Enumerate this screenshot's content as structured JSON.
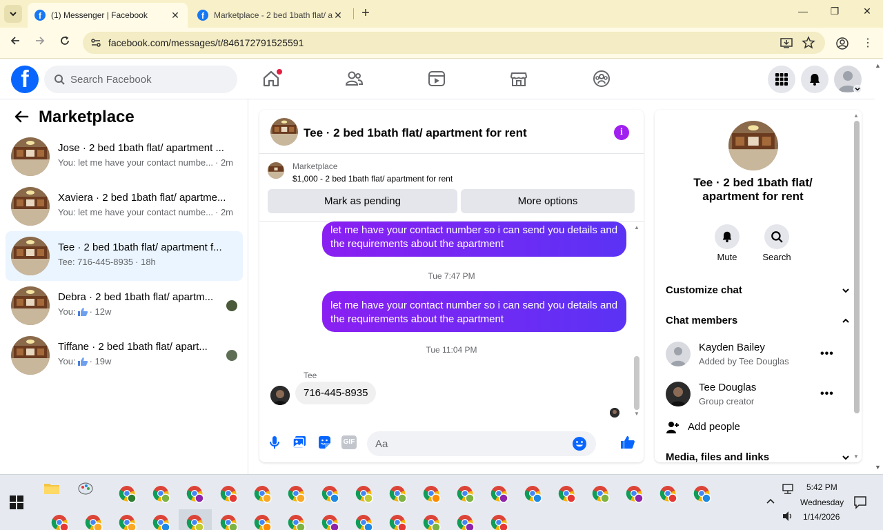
{
  "browser": {
    "tabs": [
      {
        "title": "(1) Messenger | Facebook",
        "close": "✕"
      },
      {
        "title": "Marketplace - 2 bed 1bath flat/ ap",
        "close": "✕"
      }
    ],
    "new_tab": "+",
    "window_controls": {
      "minimize": "—",
      "restore": "❐",
      "close": "✕"
    },
    "url": "facebook.com/messages/t/846172791525591"
  },
  "fb_header": {
    "logo": "f",
    "search_placeholder": "Search Facebook"
  },
  "left_pane": {
    "title": "Marketplace",
    "conversations": [
      {
        "name": "Jose · 2 bed 1bath flat/ apartment ...",
        "snippet": "You: let me have your contact numbe...",
        "time": "· 2m"
      },
      {
        "name": "Xaviera · 2 bed 1bath flat/ apartme...",
        "snippet": "You: let me have your contact numbe...",
        "time": "· 2m"
      },
      {
        "name": "Tee · 2 bed 1bath flat/ apartment f...",
        "snippet": "Tee: 716-445-8935",
        "time": "· 18h"
      },
      {
        "name": "Debra · 2 bed 1bath flat/ apartm...",
        "snippet": "You:",
        "time": "· 12w"
      },
      {
        "name": "Tiffane · 2 bed 1bath flat/ apart...",
        "snippet": "You:",
        "time": "· 19w"
      }
    ]
  },
  "chat": {
    "title": "Tee · 2 bed 1bath flat/ apartment for rent",
    "info_icon": "i",
    "marketplace_label": "Marketplace",
    "listing": "$1,000 - 2 bed 1bath flat/ apartment for rent",
    "buttons": {
      "pending": "Mark as pending",
      "more": "More options"
    },
    "messages": [
      {
        "text": "let me have your contact number so i can send you details and the requirements about the apartment"
      },
      {
        "timestamp": "Tue 7:47 PM"
      },
      {
        "text": "let me have your contact number so i can send you details and the requirements about the apartment"
      },
      {
        "timestamp": "Tue 11:04 PM"
      },
      {
        "sender": "Tee",
        "text": "716-445-8935"
      }
    ],
    "composer_placeholder": "Aa"
  },
  "info": {
    "title": "Tee · 2 bed 1bath flat/ apartment for rent",
    "actions": {
      "mute": "Mute",
      "search": "Search"
    },
    "customize": "Customize chat",
    "members_heading": "Chat members",
    "members": [
      {
        "name": "Kayden Bailey",
        "sub": "Added by Tee Douglas"
      },
      {
        "name": "Tee Douglas",
        "sub": "Group creator"
      }
    ],
    "dots": "•••",
    "add_people": "Add people",
    "media": "Media, files and links"
  },
  "taskbar": {
    "time": "5:42 PM",
    "day": "Wednesday",
    "date": "1/14/2026"
  },
  "colors": {
    "fb_blue": "#0866ff",
    "messenger_purple": "#8a1ff2",
    "selected_row": "#ebf5ff",
    "tab_bar": "#f8f0c8"
  }
}
